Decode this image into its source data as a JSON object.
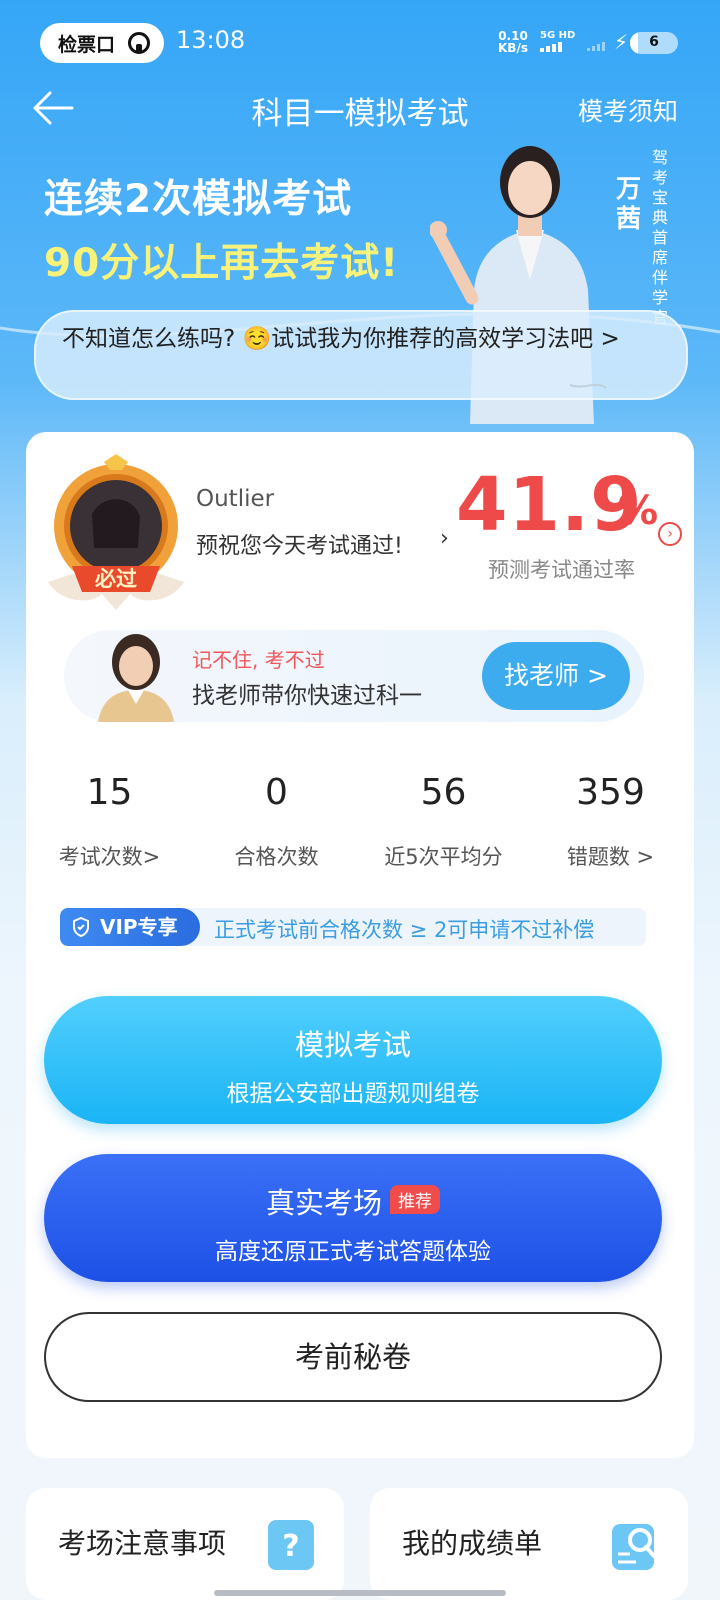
{
  "status_bar": {
    "app_pill": "检票口",
    "time": "13:08",
    "net_speed_value": "0.10",
    "net_speed_unit": "KB/s",
    "signal_label": "5G HD",
    "battery_level": "6"
  },
  "header": {
    "title": "科目一模拟考试",
    "right_link": "模考须知"
  },
  "banner": {
    "line1": "连续2次模拟考试",
    "line2": "90分以上再去考试!",
    "instructor_name": "万茜",
    "instructor_title": "驾考宝典首席伴学官",
    "tip": "不知道怎么练吗? ☺️试试我为你推荐的高效学习法吧 >"
  },
  "profile": {
    "badge_text": "必过",
    "user_name": "Outlier",
    "greeting": "预祝您今天考试通过!",
    "pass_rate_value": "41.9",
    "pass_rate_unit": "%",
    "pass_rate_label": "预测考试通过率"
  },
  "teacher_promo": {
    "tag": "记不住, 考不过",
    "text": "找老师带你快速过科一",
    "button": "找老师 >"
  },
  "stats": [
    {
      "value": "15",
      "label": "考试次数>"
    },
    {
      "value": "0",
      "label": "合格次数"
    },
    {
      "value": "56",
      "label": "近5次平均分"
    },
    {
      "value": "359",
      "label": "错题数 >"
    }
  ],
  "vip": {
    "tag": "VIP专享",
    "text": "正式考试前合格次数 ≥ 2可申请不过补偿"
  },
  "actions": {
    "mock_title": "模拟考试",
    "mock_sub": "根据公安部出题规则组卷",
    "real_title": "真实考场",
    "real_badge": "推荐",
    "real_sub": "高度还原正式考试答题体验",
    "secret": "考前秘卷"
  },
  "bottom": {
    "notes": "考场注意事项",
    "report": "我的成绩单"
  },
  "colors": {
    "accent_blue": "#35a6f7",
    "pass_rate_red": "#ef4a4a",
    "mock_button": "#1ab4f6",
    "real_button": "#1d51e6",
    "vip_text": "#3b9de2"
  }
}
